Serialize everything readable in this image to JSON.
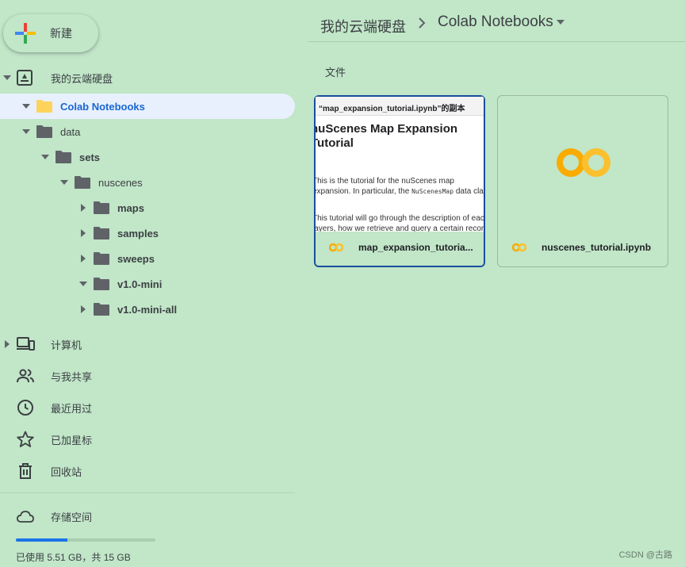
{
  "new_button": {
    "label": "新建",
    "icon": "plus-icon"
  },
  "tree": {
    "root": {
      "label": "我的云端硬盘",
      "icon": "drive-icon"
    },
    "colab": {
      "label": "Colab Notebooks"
    },
    "data": {
      "label": "data"
    },
    "sets": {
      "label": "sets"
    },
    "nuscenes": {
      "label": "nuscenes"
    },
    "maps": {
      "label": "maps"
    },
    "samples": {
      "label": "samples"
    },
    "sweeps": {
      "label": "sweeps"
    },
    "v1_mini": {
      "label": "v1.0-mini"
    },
    "v1_mini_all": {
      "label": "v1.0-mini-all"
    }
  },
  "nav": {
    "computers": {
      "label": "计算机",
      "icon": "computer-icon"
    },
    "shared": {
      "label": "与我共享",
      "icon": "people-icon"
    },
    "recent": {
      "label": "最近用过",
      "icon": "clock-icon"
    },
    "starred": {
      "label": "已加星标",
      "icon": "star-icon"
    },
    "trash": {
      "label": "回收站",
      "icon": "trash-icon"
    },
    "storage": {
      "label": "存储空间",
      "icon": "cloud-icon"
    }
  },
  "storage": {
    "text": "已使用 5.51 GB，共 15 GB",
    "used_fraction": 0.367
  },
  "breadcrumb": {
    "root": "我的云端硬盘",
    "current": "Colab Notebooks"
  },
  "main": {
    "section_label": "文件",
    "files": [
      {
        "name": "map_expansion_tutoria...",
        "preview_header": "“map_expansion_tutorial.ipynb”的副本",
        "preview_title": "nuScenes Map Expansion Tutorial",
        "preview_p1_a": "This is the tutorial for the nuScenes map expansion. In particular, the ",
        "preview_p1_code": "NuScenesMap",
        "preview_p1_b": " data class.",
        "preview_p2": "This tutorial will go through the description of each layers, how we retrieve and query a certain record"
      },
      {
        "name": "nuscenes_tutorial.ipynb"
      }
    ]
  },
  "watermark": "CSDN @古路",
  "colors": {
    "background": "#c1e6c8",
    "accent": "#1a73e8",
    "selected_bg": "#e8f0fe",
    "colab_yellow": "#f9ab00"
  }
}
